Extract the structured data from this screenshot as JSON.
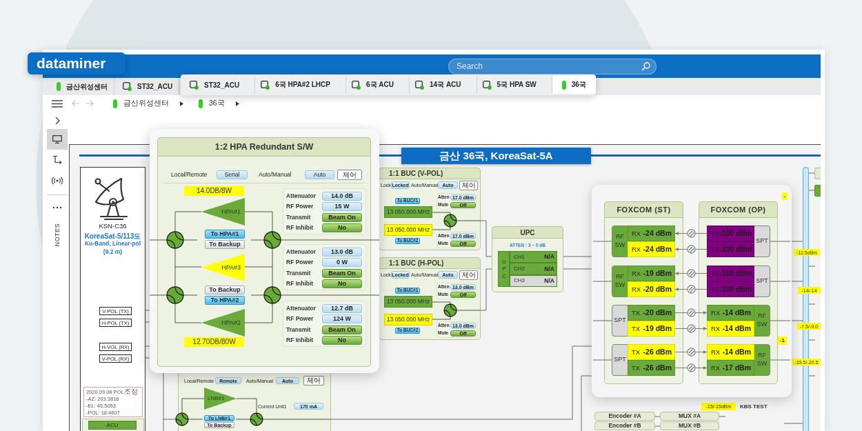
{
  "app": {
    "logo": "dataminer",
    "search": {
      "placeholder": "Search"
    }
  },
  "tabs": [
    {
      "label": "금산위성센터",
      "kind": "view",
      "selected": false
    },
    {
      "label": "ST32_ACU",
      "kind": "element",
      "selected": false
    }
  ],
  "tab_overlay": [
    {
      "label": "ST32_ACU",
      "kind": "element",
      "selected": false
    },
    {
      "label": "6국 HPA#2 LHCP",
      "kind": "element",
      "selected": false
    },
    {
      "label": "6국 ACU",
      "kind": "element",
      "selected": false
    },
    {
      "label": "14국 ACU",
      "kind": "element",
      "selected": false
    },
    {
      "label": "5국 HPA SW",
      "kind": "element",
      "selected": false
    },
    {
      "label": "36국",
      "kind": "view",
      "selected": true
    }
  ],
  "navigation": {
    "back_disabled": true,
    "forward_disabled": true,
    "breadcrumb": [
      {
        "label": "금산위성센터",
        "kind": "view"
      },
      {
        "label": "36국",
        "kind": "view"
      }
    ]
  },
  "sidebar": {
    "items": [
      {
        "kind": "expand",
        "selected": false
      },
      {
        "kind": "monitor",
        "selected": true
      },
      {
        "kind": "route",
        "selected": false
      },
      {
        "kind": "wireless",
        "selected": false
      },
      {
        "kind": "more",
        "selected": false
      }
    ],
    "notes": "NOTES"
  },
  "diagram": {
    "title": "금산 36국, KoreaSat-5A",
    "antenna": {
      "name": "KSN-C36",
      "details": [
        "KoreaSat-5/113도",
        "Ku-Band, Linear-pol",
        "(9.2 m)"
      ],
      "ports": [
        "V-POL (TX)",
        "H-POL (TX)",
        "H-VOL (RX)",
        "V-POL (RX)"
      ],
      "note": [
        "2020.09.08 POL조정",
        "-AZ: 203.3816",
        "-EL: 45.5053",
        "-POL: 18.4607"
      ],
      "button": "ACU"
    },
    "hpa": {
      "title": "1:2 HPA Redundant S/W",
      "modes": [
        {
          "label": "Local/Remote",
          "value": "Serial"
        },
        {
          "label": "Auto/Manual",
          "value": "Auto"
        }
      ],
      "control": "제어",
      "output_labels": [
        "14.0DB/8W",
        "12.70DB/80W"
      ],
      "amplifiers": [
        {
          "label": "HPA#1",
          "color": "#6aaa3a"
        },
        {
          "label": "HPA#3",
          "color": "#ffff00"
        },
        {
          "label": "HPA#2",
          "color": "#6aaa3a"
        }
      ],
      "switch_buttons": [
        [
          {
            "label": "To HPA#1",
            "selected": true
          },
          {
            "label": "To Backup",
            "selected": false
          }
        ],
        [
          {
            "label": "To Backup",
            "selected": false
          },
          {
            "label": "To HPA#2",
            "selected": true
          }
        ]
      ],
      "parameters": [
        [
          {
            "label": "Attenuator",
            "value": "14.0 dB",
            "kind": "reading"
          },
          {
            "label": "RF Power",
            "value": "15 W",
            "kind": "reading"
          },
          {
            "label": "Transmit",
            "value": "Beam On",
            "kind": "status"
          },
          {
            "label": "RF Inhibit",
            "value": "No",
            "kind": "status"
          }
        ],
        [
          {
            "label": "Attenuator",
            "value": "13.0 dB",
            "kind": "reading"
          },
          {
            "label": "RF Power",
            "value": "0 W",
            "kind": "reading"
          },
          {
            "label": "Transmit",
            "value": "Beam On",
            "kind": "status"
          },
          {
            "label": "RF Inhibit",
            "value": "No",
            "kind": "status"
          }
        ],
        [
          {
            "label": "Attenuator",
            "value": "12.7 dB",
            "kind": "reading"
          },
          {
            "label": "RF Power",
            "value": "124 W",
            "kind": "reading"
          },
          {
            "label": "Transmit",
            "value": "Beam On",
            "kind": "status"
          },
          {
            "label": "RF Inhibit",
            "value": "No",
            "kind": "status"
          }
        ]
      ]
    },
    "buc": [
      {
        "title": "1:1 BUC (V-POL)",
        "modes": [
          {
            "label": "Lock",
            "value": "Locked"
          },
          {
            "label": "Auto/Manual",
            "value": "Auto"
          }
        ],
        "control": "제어",
        "paths": [
          {
            "button": "To BUC#1",
            "selected": true,
            "frequency": "13 050.000 MHz",
            "color": "#6aaa3a",
            "settings": [
              {
                "label": "Atten",
                "value": "17.0 dBm",
                "kind": "reading"
              },
              {
                "label": "Mute",
                "value": "Off",
                "kind": "status"
              }
            ]
          },
          {
            "button": "To BUC#2",
            "selected": true,
            "frequency": "13 050.000 MHz",
            "color": "#ffff00",
            "settings": [
              {
                "label": "Atten",
                "value": "17.0 dBm",
                "kind": "reading"
              },
              {
                "label": "Mute",
                "value": "Off",
                "kind": "status"
              }
            ]
          }
        ]
      },
      {
        "title": "1:1 BUC (H-POL)",
        "modes": [
          {
            "label": "Lock",
            "value": "Locked"
          },
          {
            "label": "Auto/Manual",
            "value": "Auto"
          }
        ],
        "control": "제어",
        "paths": [
          {
            "button": "To BUC#1",
            "selected": true,
            "frequency": "13 050.000 MHz",
            "color": "#6aaa3a",
            "settings": [
              {
                "label": "Atten",
                "value": "13.0 dBm",
                "kind": "reading"
              },
              {
                "label": "Mute",
                "value": "Off",
                "kind": "status"
              }
            ]
          },
          {
            "button": "To BUC#2",
            "selected": true,
            "frequency": "13 050.000 MHz",
            "color": "#ffff00",
            "settings": [
              {
                "label": "Atten",
                "value": "13.0 dBm",
                "kind": "reading"
              },
              {
                "label": "Mute",
                "value": "Off",
                "kind": "status"
              }
            ]
          }
        ]
      }
    ],
    "upc": {
      "title": "UPC",
      "attenuation": "ATTEN : 3 ~ 0 dB",
      "block": "UPC",
      "channels": [
        {
          "label": "CH1",
          "value": "N/A",
          "color": "#6aaa3a"
        },
        {
          "label": "CH2",
          "value": "N/A",
          "color": "#6aaa3a"
        },
        {
          "label": "CH3",
          "value": "N/A",
          "color": "#d9d9d9"
        }
      ]
    },
    "lnb": {
      "modes": [
        {
          "label": "Local/Remote",
          "value": "Remote"
        },
        {
          "label": "Auto/Manual",
          "value": "Auto"
        }
      ],
      "control": "제어",
      "amplifier": {
        "label": "LNB#1",
        "color": "#6aaa3a"
      },
      "switch_buttons": [
        {
          "label": "To LNB#1",
          "selected": true
        },
        {
          "label": "To Backup",
          "selected": false
        }
      ],
      "reading": {
        "label": "Current Unit1",
        "value": "170 mA"
      }
    },
    "foxcom": {
      "edge_labels": [
        "-",
        "-1"
      ],
      "units": [
        {
          "title": "FOXCOM (ST)",
          "groups": [
            {
              "device": "RF SW",
              "kind": "rf_switch",
              "rows": [
                {
                  "direction": "RX",
                  "reading": "-24 dBm",
                  "color": "#6aaa3a"
                },
                {
                  "direction": "RX",
                  "reading": "-24 dBm",
                  "color": "#ffff00"
                }
              ]
            },
            {
              "device": "RF SW",
              "kind": "rf_switch",
              "rows": [
                {
                  "direction": "RX",
                  "reading": "-19 dBm",
                  "color": "#6aaa3a"
                },
                {
                  "direction": "RX",
                  "reading": "-20 dBm",
                  "color": "#ffff00"
                }
              ]
            },
            {
              "device": "SPT",
              "kind": "splitter",
              "rows": [
                {
                  "direction": "TX",
                  "reading": "-20 dBm",
                  "color": "#6aaa3a"
                },
                {
                  "direction": "TX",
                  "reading": "-19 dBm",
                  "color": "#ffff00"
                }
              ]
            },
            {
              "device": "SPT",
              "kind": "splitter",
              "rows": [
                {
                  "direction": "TX",
                  "reading": "-26 dBm",
                  "color": "#ffff00"
                },
                {
                  "direction": "TX",
                  "reading": "-26 dBm",
                  "color": "#6aaa3a"
                }
              ]
            }
          ]
        },
        {
          "title": "FOXCOM (OP)",
          "groups": [
            {
              "device": "SPT",
              "kind": "splitter",
              "rows": [
                {
                  "direction": "TX",
                  "reading": "-100 dBm",
                  "color": "#800080"
                },
                {
                  "direction": "TX",
                  "reading": "-100 dBm",
                  "color": "#800080"
                }
              ]
            },
            {
              "device": "SPT",
              "kind": "splitter",
              "rows": [
                {
                  "direction": "TX",
                  "reading": "-100 dBm",
                  "color": "#800080"
                },
                {
                  "direction": "TX",
                  "reading": "-100 dBm",
                  "color": "#800080"
                }
              ]
            },
            {
              "device": "RF SW",
              "kind": "rf_switch",
              "rows": [
                {
                  "direction": "RX",
                  "reading": "-14 dBm",
                  "color": "#6aaa3a"
                },
                {
                  "direction": "RX",
                  "reading": "-14 dBm",
                  "color": "#ffff00"
                }
              ]
            },
            {
              "device": "RF SW",
              "kind": "rf_switch",
              "rows": [
                {
                  "direction": "RX",
                  "reading": "-14 dBm",
                  "color": "#ffff00"
                },
                {
                  "direction": "RX",
                  "reading": "-17 dBm",
                  "color": "#6aaa3a"
                }
              ]
            }
          ]
        }
      ]
    },
    "bus_labels": [
      "-12.5dBm",
      "-14/-14",
      "-7.5/-9.0",
      "-19.5/-20.5"
    ],
    "encoders": [
      {
        "encoder": "Encoder #A",
        "mux": "MUX #A"
      },
      {
        "encoder": "Encoder #B",
        "mux": "MUX #B"
      }
    ],
    "test_feed": {
      "reading": "-15/-15dBm",
      "label": "KBS TEST"
    }
  }
}
